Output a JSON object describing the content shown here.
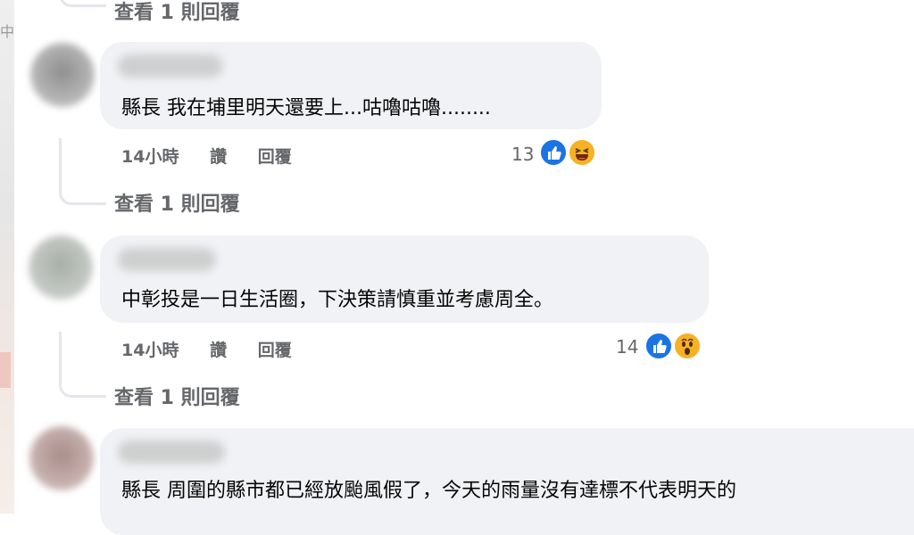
{
  "top_link": {
    "label": "查看 1 則回覆"
  },
  "comments": [
    {
      "text": "縣長 我在埔里明天還要上...咕嚕咕嚕........",
      "time": "14小時",
      "like_label": "讚",
      "reply_label": "回覆",
      "reaction_count": "13",
      "reactions": [
        "like-icon",
        "laughing-face-icon"
      ],
      "view_replies": "查看 1 則回覆"
    },
    {
      "text": "中彰投是一日生活圈，下決策請慎重並考慮周全。",
      "time": "14小時",
      "like_label": "讚",
      "reply_label": "回覆",
      "reaction_count": "14",
      "reactions": [
        "like-icon",
        "wow-face-icon"
      ],
      "view_replies": "查看 1 則回覆"
    },
    {
      "text": "縣長 周圍的縣市都已經放颱風假了，今天的雨量沒有達標不代表明天的"
    }
  ],
  "colors": {
    "bubble": "#f0f2f5",
    "meta": "#65676b",
    "like_blue": "#1b74e4",
    "emoji_yellow": "#f7b125"
  }
}
